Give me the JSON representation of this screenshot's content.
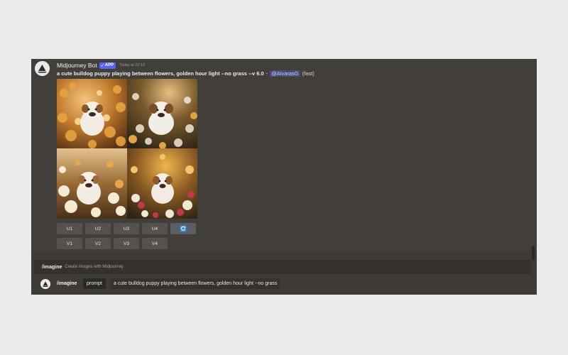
{
  "message": {
    "author": "Midjourney Bot",
    "app_badge": "APP",
    "timestamp": "Today at 22:10",
    "prompt_text": "a cute bulldog puppy playing between flowers, golden hour light --no grass --v 6.0",
    "separator": "-",
    "mention": "@AivarasG",
    "speed": "(fast)"
  },
  "image_grid": {
    "tiles": [
      "puppy-image-1",
      "puppy-image-2",
      "puppy-image-3",
      "puppy-image-4"
    ]
  },
  "upscale_buttons": [
    "U1",
    "U2",
    "U3",
    "U4"
  ],
  "reroll_button_icon": "refresh-icon",
  "variation_buttons": [
    "V1",
    "V2",
    "V3",
    "V4"
  ],
  "command_suggestion": {
    "command": "/imagine",
    "description": "Create images with Midjourney"
  },
  "input": {
    "command": "/imagine",
    "param_label": "prompt",
    "value": "a cute bulldog puppy playing between flowers, golden hour light --no grass"
  },
  "colors": {
    "page_bg": "#ebebeb",
    "chat_bg": "#423f3b",
    "button_bg": "#55524d",
    "badge": "#5865f2",
    "mention_text": "#c9cdfb"
  }
}
